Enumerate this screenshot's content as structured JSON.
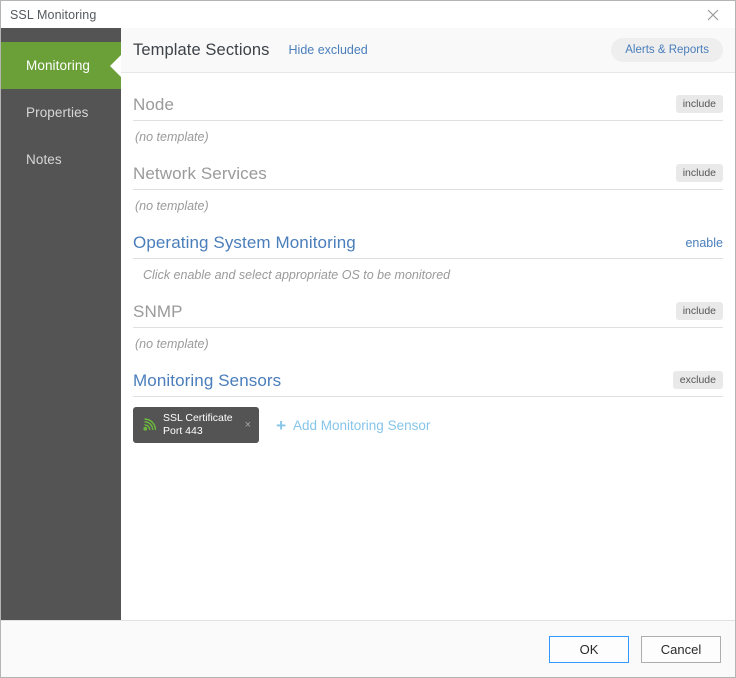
{
  "window": {
    "title": "SSL Monitoring",
    "close_icon": "close-icon"
  },
  "sidebar": {
    "items": [
      {
        "label": "Monitoring",
        "active": true
      },
      {
        "label": "Properties",
        "active": false
      },
      {
        "label": "Notes",
        "active": false
      }
    ]
  },
  "header": {
    "title": "Template Sections",
    "hide_excluded_label": "Hide excluded",
    "alerts_reports_label": "Alerts & Reports"
  },
  "sections": [
    {
      "title": "Node",
      "title_style": "muted",
      "action_label": "include",
      "action_style": "badge",
      "note": "(no template)",
      "note_indented": false
    },
    {
      "title": "Network Services",
      "title_style": "muted",
      "action_label": "include",
      "action_style": "badge",
      "note": "(no template)",
      "note_indented": false
    },
    {
      "title": "Operating System Monitoring",
      "title_style": "link",
      "action_label": "enable",
      "action_style": "link",
      "note": "Click enable and select appropriate OS to be monitored",
      "note_indented": true
    },
    {
      "title": "SNMP",
      "title_style": "muted",
      "action_label": "include",
      "action_style": "badge",
      "note": "(no template)",
      "note_indented": false
    }
  ],
  "sensors_section": {
    "title": "Monitoring Sensors",
    "action_label": "exclude",
    "chip": {
      "icon": "signal-waves-icon",
      "name": "SSL Certificate",
      "sub": "Port 443",
      "close_label": "×"
    },
    "add_label": "Add Monitoring Sensor",
    "add_plus": "+"
  },
  "footer": {
    "ok_label": "OK",
    "cancel_label": "Cancel"
  },
  "colors": {
    "accent_green": "#6aa037",
    "sidebar_dark": "#545454",
    "link_blue": "#4a7ebb",
    "add_link_blue": "#86c5ea",
    "sensor_icon_green": "#6cbb3c",
    "focus_blue": "#3399ff"
  }
}
